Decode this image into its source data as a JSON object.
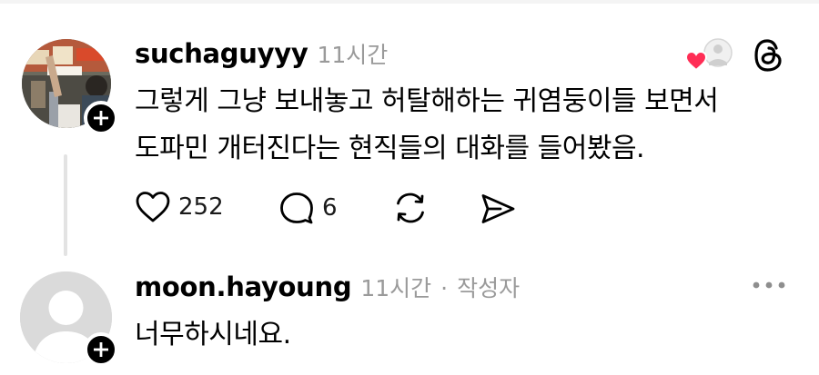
{
  "post": {
    "username": "suchaguyyy",
    "time": "11시간",
    "text_line1": "그렇게 그냥 보내놓고 허탈해하는 귀염둥이들 보면서",
    "text_line2": "도파민 개터진다는 현직들의 대화를 들어봤음.",
    "likes": "252",
    "replies": "6",
    "colors": {
      "heart": "#ff2d55"
    }
  },
  "reply": {
    "username": "moon.hayoung",
    "time": "11시간",
    "separator": "·",
    "author_tag": "작성자",
    "text": "너무하시네요."
  },
  "icons": [
    "plus-icon",
    "heart-icon",
    "threads-logo-icon",
    "comment-icon",
    "repost-icon",
    "share-icon",
    "more-icon",
    "default-avatar-icon"
  ]
}
